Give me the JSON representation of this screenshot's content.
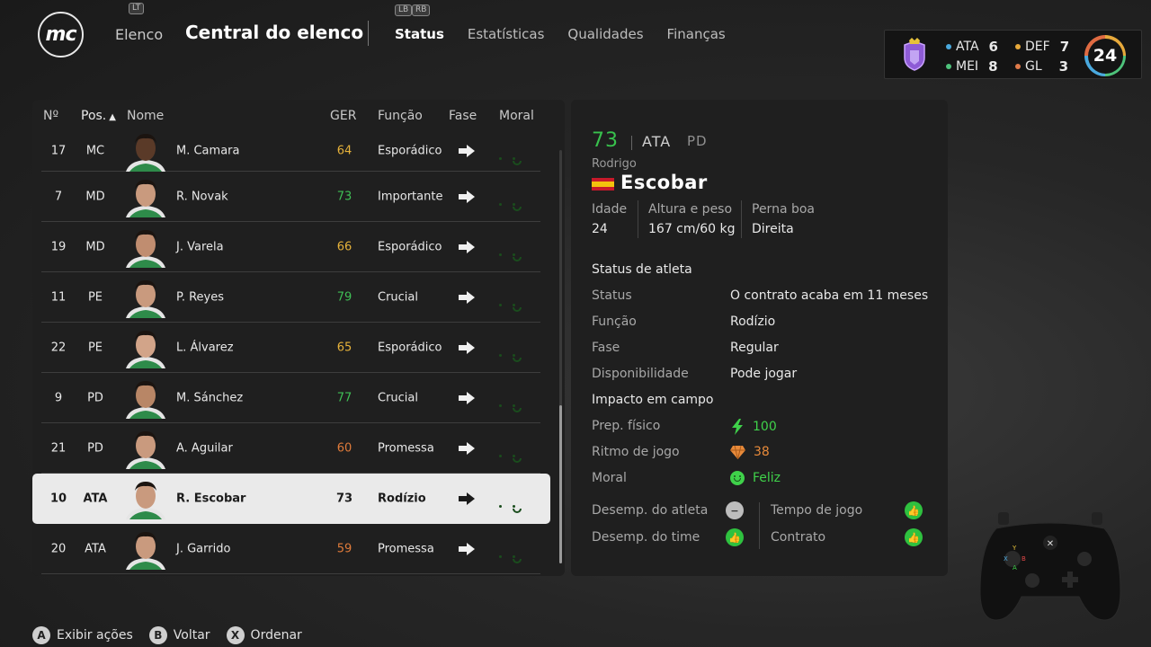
{
  "header": {
    "logo_text": "mc",
    "lt_hint": "LT",
    "lb_hint": "LB",
    "rb_hint": "RB",
    "nav_back": "Elenco",
    "title": "Central do elenco",
    "tabs": [
      {
        "label": "Status",
        "active": true
      },
      {
        "label": "Estatísticas",
        "active": false
      },
      {
        "label": "Qualidades",
        "active": false
      },
      {
        "label": "Finanças",
        "active": false
      }
    ]
  },
  "summary": {
    "positions": [
      {
        "label": "ATA",
        "count": "6",
        "color": "#4aa9de"
      },
      {
        "label": "DEF",
        "count": "7",
        "color": "#e7a93b"
      },
      {
        "label": "MEI",
        "count": "8",
        "color": "#4ec37b"
      },
      {
        "label": "GL",
        "count": "3",
        "color": "#e07b4a"
      }
    ],
    "total": "24"
  },
  "list": {
    "columns": {
      "num": "Nº",
      "pos": "Pos.",
      "name": "Nome",
      "ger": "GER",
      "func": "Função",
      "fase": "Fase",
      "moral": "Moral"
    },
    "rows": [
      {
        "num": "17",
        "pos": "MC",
        "name": "M. Camara",
        "ger": "64",
        "ger_color": "#e6b23a",
        "func": "Esporádico",
        "skin": "#5a3a28"
      },
      {
        "num": "7",
        "pos": "MD",
        "name": "R. Novak",
        "ger": "73",
        "ger_color": "#3fbf55",
        "func": "Importante",
        "skin": "#c99a7e"
      },
      {
        "num": "19",
        "pos": "MD",
        "name": "J. Varela",
        "ger": "66",
        "ger_color": "#e6b23a",
        "func": "Esporádico",
        "skin": "#c08d70"
      },
      {
        "num": "11",
        "pos": "PE",
        "name": "P. Reyes",
        "ger": "79",
        "ger_color": "#3fbf55",
        "func": "Crucial",
        "skin": "#c99a7e"
      },
      {
        "num": "22",
        "pos": "PE",
        "name": "L. Álvarez",
        "ger": "65",
        "ger_color": "#e6b23a",
        "func": "Esporádico",
        "skin": "#d2a489"
      },
      {
        "num": "9",
        "pos": "PD",
        "name": "M. Sánchez",
        "ger": "77",
        "ger_color": "#3fbf55",
        "func": "Crucial",
        "skin": "#b88666"
      },
      {
        "num": "21",
        "pos": "PD",
        "name": "A. Aguilar",
        "ger": "60",
        "ger_color": "#e07b3a",
        "func": "Promessa",
        "skin": "#c99a7e"
      },
      {
        "num": "10",
        "pos": "ATA",
        "name": "R. Escobar",
        "ger": "73",
        "ger_color": "#1b1b1b",
        "func": "Rodízio",
        "skin": "#c99a7e",
        "selected": true
      },
      {
        "num": "20",
        "pos": "ATA",
        "name": "J. Garrido",
        "ger": "59",
        "ger_color": "#e07b3a",
        "func": "Promessa",
        "skin": "#c99a7e"
      }
    ]
  },
  "detail": {
    "ovr": "73",
    "position": "ATA",
    "alt_position": "PD",
    "first_name": "Rodrigo",
    "last_name": "Escobar",
    "age_label": "Idade",
    "age": "24",
    "hw_label": "Altura e peso",
    "hw": "167 cm/60 kg",
    "foot_label": "Perna boa",
    "foot": "Direita",
    "athlete_status_title": "Status de atleta",
    "status_items": [
      {
        "label": "Status",
        "value": "O contrato acaba em 11 meses"
      },
      {
        "label": "Função",
        "value": "Rodízio"
      },
      {
        "label": "Fase",
        "value": "Regular"
      },
      {
        "label": "Disponibilidade",
        "value": "Pode jogar"
      }
    ],
    "impact_title": "Impacto em campo",
    "fitness_label": "Prep. físico",
    "fitness_value": "100",
    "fitness_color": "#3fd14a",
    "sharpness_label": "Ritmo de jogo",
    "sharpness_value": "38",
    "sharpness_color": "#e88a3a",
    "morale_label": "Moral",
    "morale_value": "Feliz",
    "perf_athlete_label": "Desemp. do atleta",
    "perf_team_label": "Desemp. do time",
    "playtime_label": "Tempo de jogo",
    "contract_label": "Contrato"
  },
  "footer": {
    "actions": [
      {
        "key": "A",
        "label": "Exibir ações"
      },
      {
        "key": "B",
        "label": "Voltar"
      },
      {
        "key": "X",
        "label": "Ordenar"
      }
    ]
  }
}
